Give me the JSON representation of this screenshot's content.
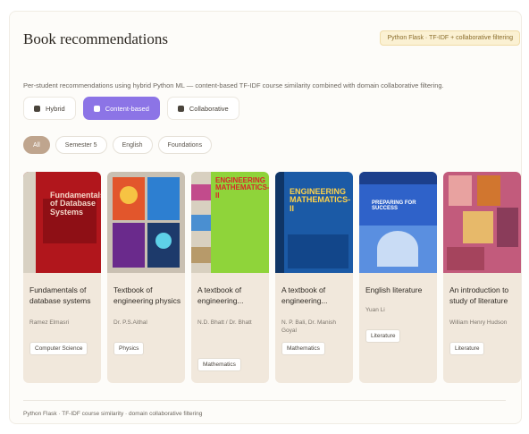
{
  "header": {
    "title": "Book recommendations",
    "badge": "Python Flask · TF-IDF + collaborative filtering"
  },
  "subtitle": "Per-student recommendations using hybrid Python ML — content-based TF-IDF course similarity combined with domain collaborative filtering.",
  "modes": [
    {
      "label": "Hybrid",
      "icon": "sparkle-icon",
      "active": false
    },
    {
      "label": "Content-based",
      "icon": "document-icon",
      "active": true
    },
    {
      "label": "Collaborative",
      "icon": "users-icon",
      "active": false
    }
  ],
  "filters": [
    {
      "label": "All",
      "active": true
    },
    {
      "label": "Semester 5",
      "active": false
    },
    {
      "label": "English",
      "active": false
    },
    {
      "label": "Foundations",
      "active": false
    }
  ],
  "books": [
    {
      "title": "Fundamentals of database systems",
      "author": "Ramez Elmasri",
      "category": "Computer Science",
      "cover": {
        "bg": "#b1161c",
        "spine": "#d8d1c3",
        "text": "Fundamentals of Database Systems",
        "text_color": "#f3d6c8"
      }
    },
    {
      "title": "Textbook of engineering physics",
      "author": "Dr. P.S.Aithal",
      "category": "Physics",
      "cover": {
        "bg": "#1d3a6b",
        "spine": "#c9c0b2",
        "text": "",
        "text_color": "#ffffff"
      }
    },
    {
      "title": "A textbook of engineering...",
      "author": "N.D. Bhatt / Dr. Bhatt",
      "category": "Mathematics",
      "cover": {
        "bg": "#8fd43a",
        "spine": "#d8d0c0",
        "text": "ENGINEERING MATHEMATICS-II",
        "text_color": "#d8262a"
      }
    },
    {
      "title": "A textbook of engineering...",
      "author": "N. P. Bali, Dr. Manish Goyal",
      "category": "Mathematics",
      "cover": {
        "bg": "#1b5aa6",
        "spine": "#0f3566",
        "text": "ENGINEERING MATHEMATICS-II",
        "text_color": "#ffd24a"
      }
    },
    {
      "title": "English literature",
      "author": "Yuan Li",
      "category": "Literature",
      "cover": {
        "bg": "#2f62c9",
        "spine": "#1c3f8c",
        "text": "PREPARING FOR SUCCESS",
        "text_color": "#ffffff"
      }
    },
    {
      "title": "An introduction to study of literature",
      "author": "William Henry Hudson",
      "category": "Literature",
      "cover": {
        "bg": "#c25b7c",
        "spine": "#9a3f5f",
        "text": "",
        "text_color": "#ffffff"
      }
    }
  ],
  "footer": "Python Flask · TF-IDF course similarity · domain collaborative filtering"
}
